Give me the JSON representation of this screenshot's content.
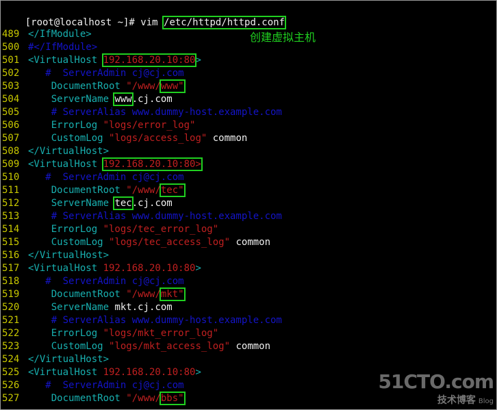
{
  "prompt": {
    "text_before": "[root@localhost ~]# vim ",
    "path": "/etc/httpd/httpd.conf"
  },
  "annotation": "创建虚拟主机",
  "watermark": {
    "site": "51CTO.com",
    "tagline": "技术博客",
    "blog": "Blog"
  },
  "colors": {
    "line_number": "#c8c800",
    "tag": "#18b0b0",
    "string": "#c02020",
    "comment": "#1414c8",
    "plain": "#f0f0f0",
    "highlight_box": "#20d020"
  },
  "lines": [
    {
      "num": "489",
      "segs": [
        {
          "t": "</IfModule>",
          "c": "cyan"
        }
      ]
    },
    {
      "num": "500",
      "segs": [
        {
          "t": "#</IfModule>",
          "c": "blue"
        }
      ]
    },
    {
      "num": "501",
      "segs": [
        {
          "t": "<VirtualHost ",
          "c": "cyan"
        },
        {
          "t": "192.168.20.10:80",
          "c": "red",
          "box": true
        },
        {
          "t": ">",
          "c": "cyan"
        }
      ]
    },
    {
      "num": "502",
      "segs": [
        {
          "t": "   #  ServerAdmin cj@cj.com",
          "c": "blue"
        }
      ]
    },
    {
      "num": "503",
      "segs": [
        {
          "t": "    DocumentRoot ",
          "c": "cyan"
        },
        {
          "t": "\"/www/",
          "c": "red"
        },
        {
          "t": "www\"",
          "c": "red",
          "box": true
        }
      ]
    },
    {
      "num": "504",
      "segs": [
        {
          "t": "    ServerName ",
          "c": "cyan"
        },
        {
          "t": "www",
          "c": "white",
          "box": true
        },
        {
          "t": ".cj.com",
          "c": "white"
        }
      ]
    },
    {
      "num": "505",
      "segs": [
        {
          "t": "    # ServerAlias www.dummy-host.example.com",
          "c": "blue"
        }
      ]
    },
    {
      "num": "506",
      "segs": [
        {
          "t": "    ErrorLog ",
          "c": "cyan"
        },
        {
          "t": "\"logs/error_log\"",
          "c": "red"
        }
      ]
    },
    {
      "num": "507",
      "segs": [
        {
          "t": "    CustomLog ",
          "c": "cyan"
        },
        {
          "t": "\"logs/access_log\"",
          "c": "red"
        },
        {
          "t": " common",
          "c": "white"
        }
      ]
    },
    {
      "num": "508",
      "segs": [
        {
          "t": "</VirtualHost>",
          "c": "cyan"
        }
      ]
    },
    {
      "num": "509",
      "segs": [
        {
          "t": "<VirtualHost ",
          "c": "cyan"
        },
        {
          "t": "192.168.20.10:80>",
          "c": "red",
          "box": true
        }
      ]
    },
    {
      "num": "510",
      "segs": [
        {
          "t": "   #  ServerAdmin cj@cj.com",
          "c": "blue"
        }
      ]
    },
    {
      "num": "511",
      "segs": [
        {
          "t": "    DocumentRoot ",
          "c": "cyan"
        },
        {
          "t": "\"/www/",
          "c": "red"
        },
        {
          "t": "tec\"",
          "c": "red",
          "box": true
        }
      ]
    },
    {
      "num": "512",
      "segs": [
        {
          "t": "    ServerName ",
          "c": "cyan"
        },
        {
          "t": "tec",
          "c": "white",
          "box": true
        },
        {
          "t": ".cj.com",
          "c": "white"
        }
      ]
    },
    {
      "num": "513",
      "segs": [
        {
          "t": "    # ServerAlias www.dummy-host.example.com",
          "c": "blue"
        }
      ]
    },
    {
      "num": "514",
      "segs": [
        {
          "t": "    ErrorLog ",
          "c": "cyan"
        },
        {
          "t": "\"logs/tec_error_log\"",
          "c": "red"
        }
      ]
    },
    {
      "num": "515",
      "segs": [
        {
          "t": "    CustomLog ",
          "c": "cyan"
        },
        {
          "t": "\"logs/tec_access_log\"",
          "c": "red"
        },
        {
          "t": " common",
          "c": "white"
        }
      ]
    },
    {
      "num": "516",
      "segs": [
        {
          "t": "</VirtualHost>",
          "c": "cyan"
        }
      ]
    },
    {
      "num": "517",
      "segs": [
        {
          "t": "<VirtualHost ",
          "c": "cyan"
        },
        {
          "t": "192.168.20.10:80",
          "c": "red"
        },
        {
          "t": ">",
          "c": "cyan"
        }
      ]
    },
    {
      "num": "518",
      "segs": [
        {
          "t": "   #  ServerAdmin cj@cj.com",
          "c": "blue"
        }
      ]
    },
    {
      "num": "519",
      "segs": [
        {
          "t": "    DocumentRoot ",
          "c": "cyan"
        },
        {
          "t": "\"/www/",
          "c": "red"
        },
        {
          "t": "mkt\"",
          "c": "red",
          "box": true
        }
      ]
    },
    {
      "num": "520",
      "segs": [
        {
          "t": "    ServerName ",
          "c": "cyan"
        },
        {
          "t": "mkt.cj.com",
          "c": "white"
        }
      ]
    },
    {
      "num": "521",
      "segs": [
        {
          "t": "    # ServerAlias www.dummy-host.example.com",
          "c": "blue"
        }
      ]
    },
    {
      "num": "522",
      "segs": [
        {
          "t": "    ErrorLog ",
          "c": "cyan"
        },
        {
          "t": "\"logs/mkt_error_log\"",
          "c": "red"
        }
      ]
    },
    {
      "num": "523",
      "segs": [
        {
          "t": "    CustomLog ",
          "c": "cyan"
        },
        {
          "t": "\"logs/mkt_access_log\"",
          "c": "red"
        },
        {
          "t": " common",
          "c": "white"
        }
      ]
    },
    {
      "num": "524",
      "segs": [
        {
          "t": "</VirtualHost>",
          "c": "cyan"
        }
      ]
    },
    {
      "num": "525",
      "segs": [
        {
          "t": "<VirtualHost ",
          "c": "cyan"
        },
        {
          "t": "192.168.20.10:80",
          "c": "red"
        },
        {
          "t": ">",
          "c": "cyan"
        }
      ]
    },
    {
      "num": "526",
      "segs": [
        {
          "t": "   #  ServerAdmin cj@cj.com",
          "c": "blue"
        }
      ]
    },
    {
      "num": "527",
      "segs": [
        {
          "t": "    DocumentRoot ",
          "c": "cyan"
        },
        {
          "t": "\"/www/",
          "c": "red"
        },
        {
          "t": "bbs\"",
          "c": "red",
          "box": true
        }
      ]
    }
  ]
}
